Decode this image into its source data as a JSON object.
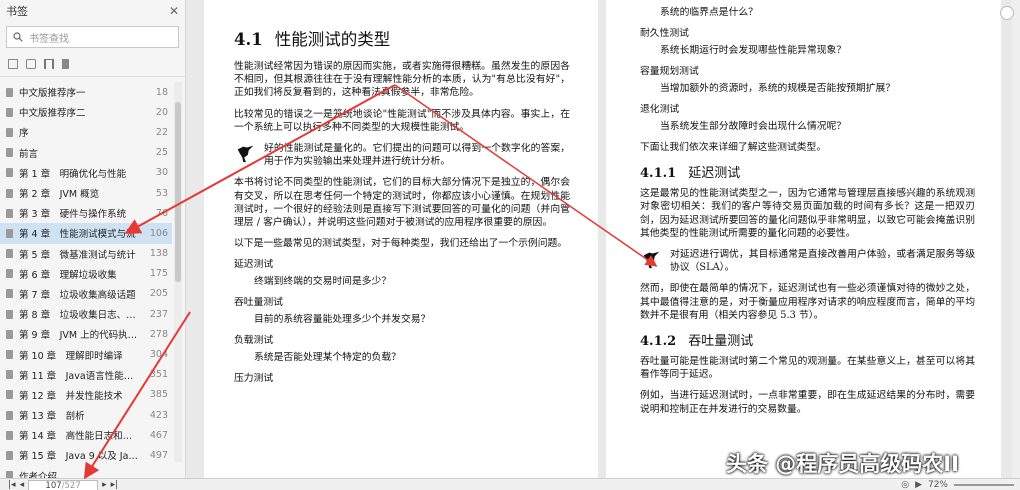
{
  "sidebar": {
    "title": "书签",
    "search_placeholder": "书签查找",
    "items": [
      {
        "label": "中文版推荐序一",
        "page": "18"
      },
      {
        "label": "中文版推荐序二",
        "page": "20"
      },
      {
        "label": "序",
        "page": "22"
      },
      {
        "label": "前言",
        "page": "25"
      },
      {
        "label": "第 1 章　明确优化与性能",
        "page": "30"
      },
      {
        "label": "第 2 章　JVM 概览",
        "page": "53"
      },
      {
        "label": "第 3 章　硬件与操作系统",
        "page": "76"
      },
      {
        "label": "第 4 章　性能测试模式与流",
        "page": "106"
      },
      {
        "label": "第 5 章　微基准测试与统计",
        "page": "138"
      },
      {
        "label": "第 6 章　理解垃圾收集",
        "page": "175"
      },
      {
        "label": "第 7 章　垃圾收集高级话题",
        "page": "205"
      },
      {
        "label": "第 8 章　垃圾收集日志、…",
        "page": "237"
      },
      {
        "label": "第 9 章　JVM 上的代码执…",
        "page": "278"
      },
      {
        "label": "第 10 章　理解即时编译",
        "page": "304"
      },
      {
        "label": "第 11 章　Java语言性能…",
        "page": "351"
      },
      {
        "label": "第 12 章　并发性能技术",
        "page": "385"
      },
      {
        "label": "第 13 章　剖析",
        "page": "423"
      },
      {
        "label": "第 14 章　高性能日志和…",
        "page": "467"
      },
      {
        "label": "第 15 章　Java 9 以及 Ja…",
        "page": "497"
      },
      {
        "label": "作者介绍",
        "page": ""
      }
    ],
    "active_index": 7
  },
  "left_page": {
    "heading_num": "4.1",
    "heading": "性能测试的类型",
    "p1": "性能测试经常因为错误的原因而实施，或者实施得很糟糕。虽然发生的原因各不相同，但其根源往往在于没有理解性能分析的本质，认为\"有总比没有好\"，正如我们将反复看到的，这种看法真假参半，非常危险。",
    "p2": "比较常见的错误之一是笼统地谈论\"性能测试\"而不涉及具体内容。事实上，在一个系统上可以执行多种不同类型的大规模性能测试。",
    "note": "好的性能测试是量化的。它们提出的问题可以得到一个数字化的答案，用于作为实验输出来处理并进行统计分析。",
    "p3": "本书将讨论不同类型的性能测试，它们的目标大部分情况下是独立的，偶尔会有交叉，所以在思考任何一个特定的测试时，你都应该小心谨慎。在规划性能测试时，一个很好的经验法则是直接写下测试要回答的可量化的问题（并向管理层 / 客户确认），并说明这些问题对于被测试的应用程序很重要的原因。",
    "p4": "以下是一些最常见的测试类型，对于每种类型，我们还给出了一个示例问题。",
    "types": [
      {
        "term": "延迟测试",
        "question": "终端到终端的交易时间是多少？"
      },
      {
        "term": "吞吐量测试",
        "question": "目前的系统容量能处理多少个并发交易？"
      },
      {
        "term": "负载测试",
        "question": "系统是否能处理某个特定的负载？"
      },
      {
        "term": "压力测试",
        "question": ""
      }
    ]
  },
  "right_page": {
    "q_stress": "系统的临界点是什么？",
    "types": [
      {
        "term": "耐久性测试",
        "question": "系统长期运行时会发现哪些性能异常现象？"
      },
      {
        "term": "容量规划测试",
        "question": "当增加额外的资源时，系统的规模是否能按预期扩展？"
      },
      {
        "term": "退化测试",
        "question": "当系统发生部分故障时会出现什么情况呢？"
      }
    ],
    "intro": "下面让我们依次来详细了解这些测试类型。",
    "s1_num": "4.1.1",
    "s1_title": "延迟测试",
    "s1_p1": "这是最常见的性能测试类型之一，因为它通常与管理层直接感兴趣的系统观测对象密切相关：我们的客户等待交易页面加载的时间有多长？这是一把双刃剑，因为延迟测试所要回答的量化问题似乎非常明显，以致它可能会掩盖识别其他类型的性能测试所需要的量化问题的必要性。",
    "s1_note": "对延迟进行调优，其目标通常是直接改善用户体验，或者满足服务等级协议（SLA）。",
    "s1_p2": "然而，即使在最简单的情况下，延迟测试也有一些必须谨慎对待的微妙之处，其中最值得注意的是，对于衡量应用程序对请求的响应程度而言，简单的平均数并不是很有用（相关内容参见 5.3 节）。",
    "s2_num": "4.1.2",
    "s2_title": "吞吐量测试",
    "s2_p1": "吞吐量可能是性能测试时第二个常见的观测量。在某些意义上，甚至可以将其看作等同于延迟。",
    "s2_p2": "例如，当进行延迟测试时，一点非常重要，即在生成延迟结果的分布时，需要说明和控制正在并发进行的交易数量。"
  },
  "toolbar": {
    "page_current": "107",
    "page_total": "/527",
    "zoom": "72%"
  },
  "watermark": "头条 @程序员高级码农II",
  "colors": {
    "arrow": "#e53935",
    "active_bg": "#cfe2f3"
  }
}
